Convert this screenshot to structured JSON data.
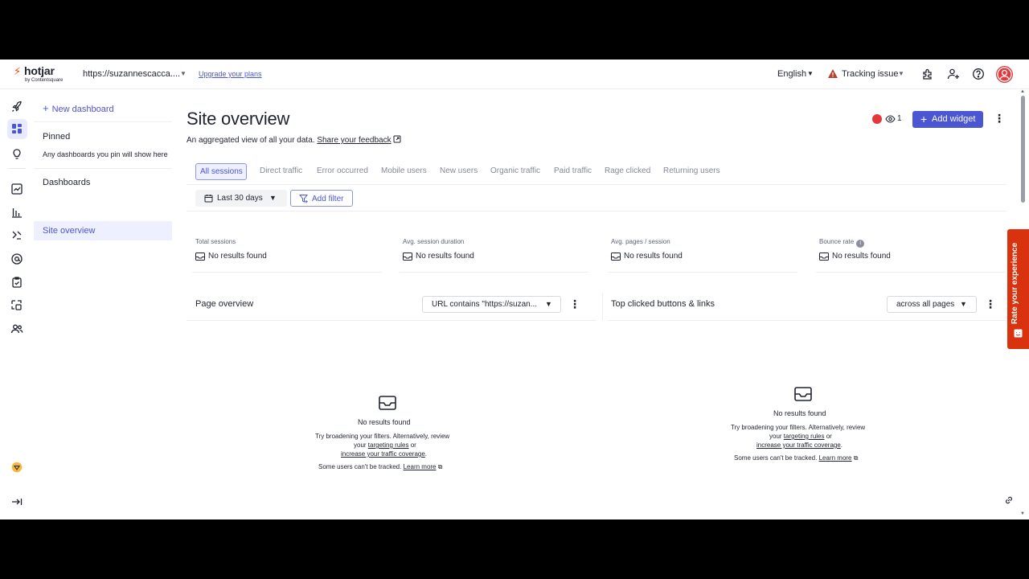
{
  "header": {
    "logo_text": "hotjar",
    "logo_sub": "by Contentsquare",
    "site_url": "https://suzannescacca....",
    "upgrade_link": "Upgrade your plans",
    "language": "English",
    "tracking": "Tracking issue",
    "icons": [
      "integrations-icon",
      "add-user-icon",
      "help-icon",
      "user-avatar"
    ]
  },
  "rail": {
    "icons": [
      "rocket-icon",
      "dashboard-icon",
      "lightbulb-icon",
      "trends-icon",
      "funnels-icon",
      "recordings-icon",
      "surveys-icon",
      "feedback-icon",
      "heatmaps-icon",
      "interviews-icon",
      "plan-icon",
      "collapse-icon"
    ]
  },
  "panel": {
    "new_dashboard": "New dashboard",
    "pinned_title": "Pinned",
    "pinned_note": "Any dashboards you pin will show here",
    "dashboards_title": "Dashboards",
    "selected_dashboard": "Site overview"
  },
  "main": {
    "title": "Site overview",
    "subtitle": "An aggregated view of all your data.",
    "feedback_link": "Share your feedback",
    "viewer_count": "1",
    "add_widget": "Add widget",
    "tabs": [
      "All sessions",
      "Direct traffic",
      "Error occurred",
      "Mobile users",
      "New users",
      "Organic traffic",
      "Paid traffic",
      "Rage clicked",
      "Returning users"
    ],
    "date_range": "Last 30 days",
    "add_filter": "Add filter",
    "metrics": [
      {
        "label": "Total sessions",
        "value": "No results found"
      },
      {
        "label": "Avg. session duration",
        "value": "No results found"
      },
      {
        "label": "Avg. pages / session",
        "value": "No results found"
      },
      {
        "label": "Bounce rate",
        "value": "No results found"
      }
    ],
    "cards": [
      {
        "title": "Page overview",
        "select": "URL contains \"https://suzan...",
        "empty_title": "No results found",
        "empty_line1": "Try broadening your filters. Alternatively, review",
        "empty_line2_a": "your",
        "empty_line2_link": "targeting rules",
        "empty_line2_b": "or",
        "empty_line3_link": "increase your traffic coverage",
        "empty_line3_end": ".",
        "empty_line4": "Some users can't be tracked.",
        "learn_more": "Learn more"
      },
      {
        "title": "Top clicked buttons & links",
        "select": "across all pages",
        "empty_title": "No results found",
        "empty_line1": "Try broadening your filters. Alternatively, review",
        "empty_line2_a": "your",
        "empty_line2_link": "targeting rules",
        "empty_line2_b": "or",
        "empty_line3_link": "increase your traffic coverage",
        "empty_line3_end": ".",
        "empty_line4": "Some users can't be tracked.",
        "learn_more": "Learn more"
      }
    ]
  },
  "rate_tab": "Rate your experience",
  "colors": {
    "accent": "#4b56d2",
    "brand": "#ff3c00",
    "rate": "#d9320f",
    "avatar": "#e5383b"
  }
}
